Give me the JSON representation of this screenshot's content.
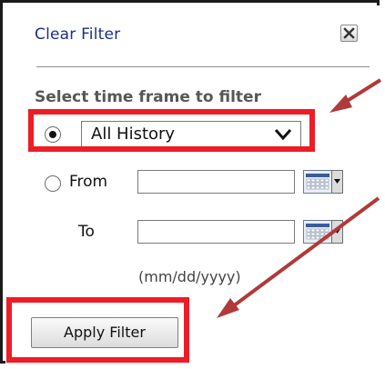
{
  "panel": {
    "clear_filter_label": "Clear Filter",
    "close_icon": "close-icon",
    "section_label": "Select time frame to filter"
  },
  "time_frame": {
    "option_all_history": {
      "selected": true,
      "dropdown_value": "All History",
      "dropdown_icon": "chevron-down-icon"
    },
    "option_range": {
      "selected": false,
      "from_label": "From",
      "from_value": "",
      "to_label": "To",
      "to_value": "",
      "calendar_icon": "calendar-icon",
      "date_format_hint": "(mm/dd/yyyy)"
    }
  },
  "apply_button_label": "Apply Filter",
  "annotations": {
    "highlight_color": "#ee1c25",
    "arrow_color": "#b03a3a"
  }
}
